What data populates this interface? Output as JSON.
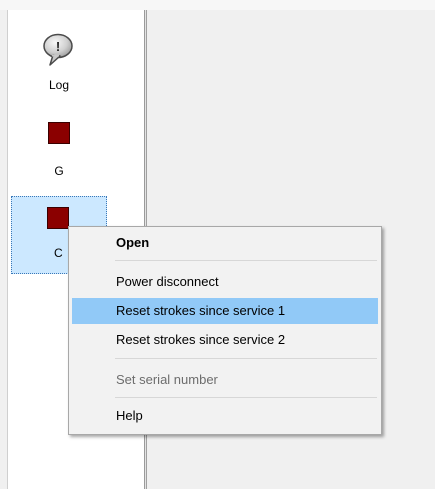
{
  "devices": [
    {
      "label": "Log",
      "icon": "speech-bubble-exclamation-icon"
    },
    {
      "label": "G",
      "icon": "red-square-icon"
    },
    {
      "label": "C",
      "icon": "red-square-icon"
    }
  ],
  "context_menu": {
    "items": [
      {
        "label": "Open"
      },
      {
        "label": "Power disconnect"
      },
      {
        "label": "Reset strokes since service 1"
      },
      {
        "label": "Reset strokes since service 2"
      },
      {
        "label": "Set serial number"
      },
      {
        "label": "Help"
      }
    ]
  },
  "colors": {
    "selection": "#cce8ff",
    "menu_highlight": "#91c9f7",
    "device_red": "#8b0000"
  }
}
